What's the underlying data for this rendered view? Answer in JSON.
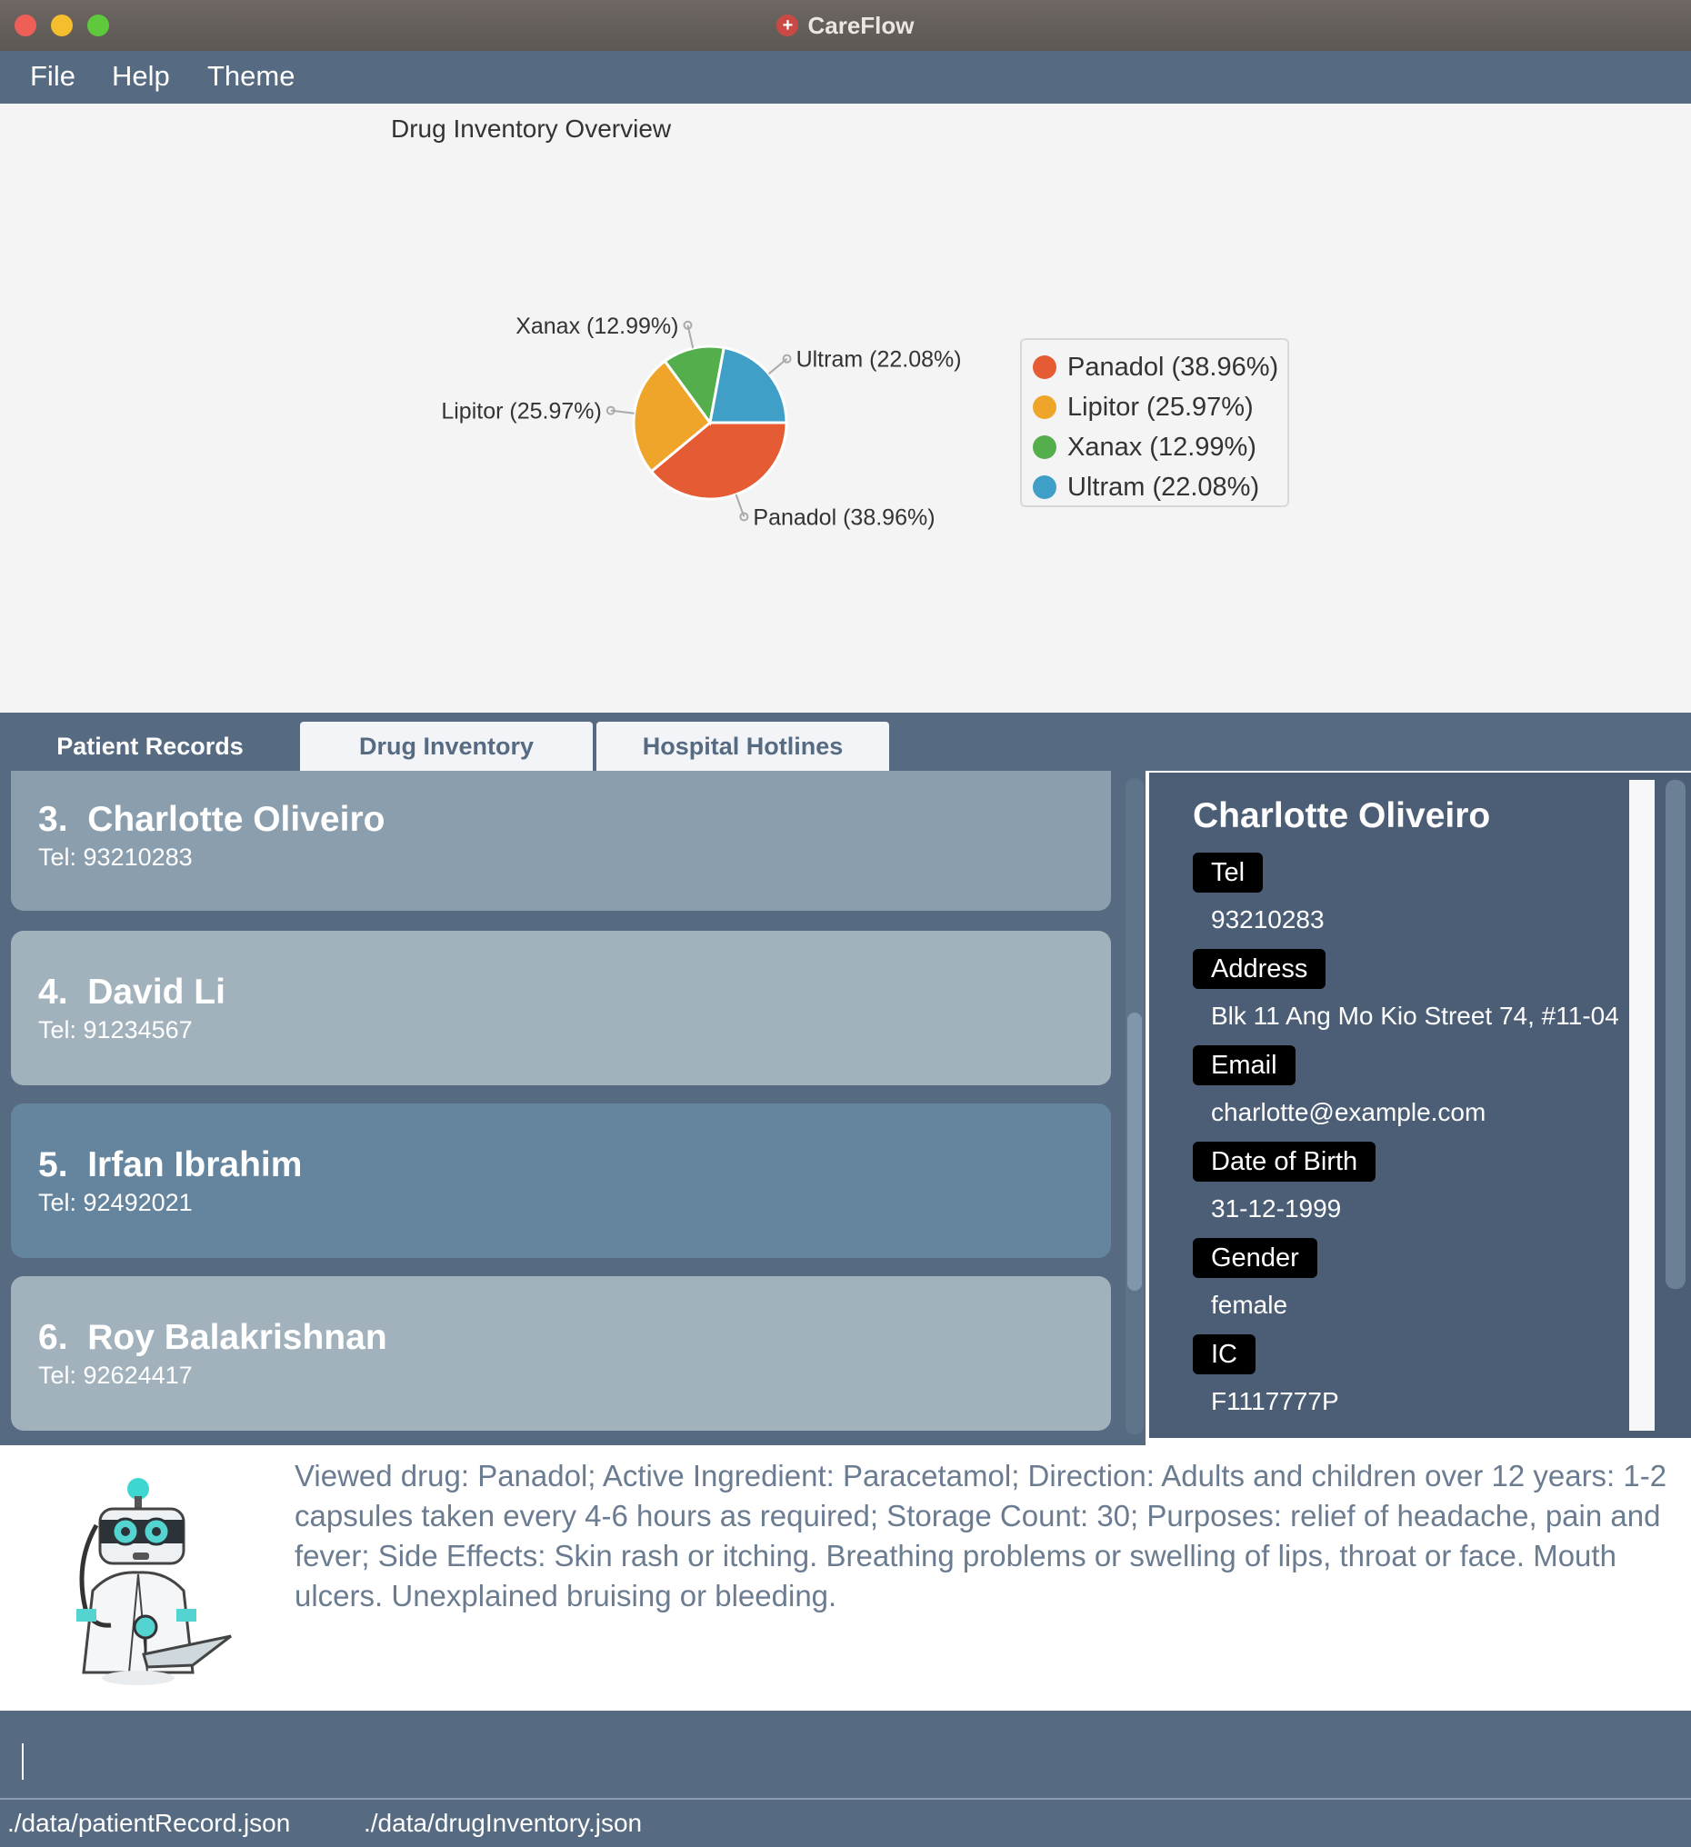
{
  "window": {
    "title": "CareFlow"
  },
  "menu": [
    "File",
    "Help",
    "Theme"
  ],
  "chart_data": {
    "type": "pie",
    "title": "Drug Inventory Overview",
    "slices": [
      {
        "label": "Panadol (38.96%)",
        "name": "Panadol",
        "value": 38.96,
        "color": "#e55b33"
      },
      {
        "label": "Lipitor (25.97%)",
        "name": "Lipitor",
        "value": 25.97,
        "color": "#eea52a"
      },
      {
        "label": "Xanax (12.99%)",
        "name": "Xanax",
        "value": 12.99,
        "color": "#55ae4c"
      },
      {
        "label": "Ultram (22.08%)",
        "name": "Ultram",
        "value": 22.08,
        "color": "#3f9fc6"
      }
    ],
    "legend_position": "right"
  },
  "tabs": [
    {
      "label": "Patient Records",
      "active": true
    },
    {
      "label": "Drug Inventory",
      "active": false
    },
    {
      "label": "Hospital Hotlines",
      "active": false
    }
  ],
  "patients": [
    {
      "index": "3.",
      "name": "Charlotte Oliveiro",
      "tel": "Tel: 93210283",
      "bg": "#8a9eae"
    },
    {
      "index": "4.",
      "name": "David Li",
      "tel": "Tel: 91234567",
      "bg": "#a2b2bd"
    },
    {
      "index": "5.",
      "name": "Irfan Ibrahim",
      "tel": "Tel: 92492021",
      "bg": "#65859e"
    },
    {
      "index": "6.",
      "name": "Roy Balakrishnan",
      "tel": "Tel: 92624417",
      "bg": "#a2b2bd"
    }
  ],
  "detail": {
    "name": "Charlotte Oliveiro",
    "fields": [
      {
        "label": "Tel",
        "value": "93210283"
      },
      {
        "label": "Address",
        "value": "Blk 11 Ang Mo Kio Street 74, #11-04"
      },
      {
        "label": "Email",
        "value": "charlotte@example.com"
      },
      {
        "label": "Date of Birth",
        "value": "31-12-1999"
      },
      {
        "label": "Gender",
        "value": "female"
      },
      {
        "label": "IC",
        "value": "F1117777P"
      }
    ]
  },
  "result_message": "Viewed drug: Panadol; Active Ingredient: Paracetamol; Direction: Adults and children over 12 years: 1-2 capsules taken every 4-6 hours as required; Storage Count: 30; Purposes: relief of headache, pain and fever; Side Effects: Skin rash or itching. Breathing problems or swelling of lips, throat or face. Mouth ulcers. Unexplained bruising or bleeding.",
  "command": {
    "value": ""
  },
  "status": {
    "patient_file": "./data/patientRecord.json",
    "drug_file": "./data/drugInventory.json"
  }
}
